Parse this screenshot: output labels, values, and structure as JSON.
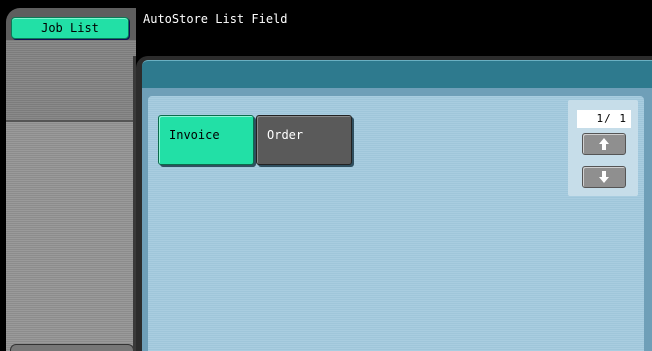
{
  "sidebar": {
    "job_list_label": "Job List"
  },
  "header": {
    "title": "AutoStore List Field"
  },
  "fields": [
    {
      "label": "Invoice",
      "selected": true
    },
    {
      "label": "Order",
      "selected": false
    }
  ],
  "pager": {
    "page_text": "1/ 1",
    "up_icon": "arrow-up-icon",
    "down_icon": "arrow-down-icon"
  },
  "colors": {
    "accent": "#22e0a6",
    "header_bar": "#2e7a8e",
    "panel": "#a9cde0",
    "unselected": "#5a5a5a"
  }
}
